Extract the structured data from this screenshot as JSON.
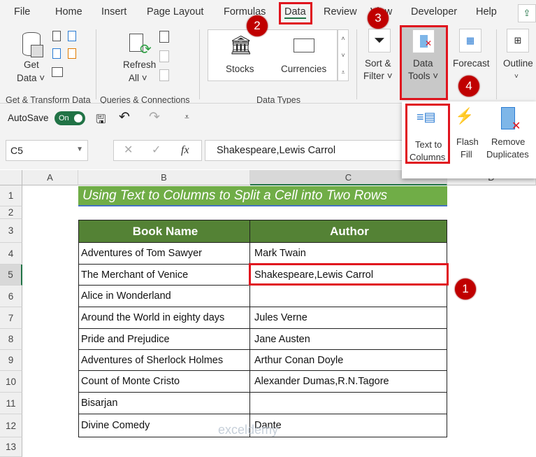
{
  "tabs": [
    "File",
    "Home",
    "Insert",
    "Page Layout",
    "Formulas",
    "Data",
    "Review",
    "View",
    "Developer",
    "Help"
  ],
  "active_tab": "Data",
  "ribbon": {
    "get_data": "Get",
    "get_data2": "Data ˅",
    "refresh": "Refresh",
    "refresh2": "All ˅",
    "stocks": "Stocks",
    "currencies": "Currencies",
    "sort": "Sort &",
    "sort2": "Filter ˅",
    "data_tools": "Data",
    "data_tools2": "Tools ˅",
    "forecast": "Forecast",
    "outline": "Outline",
    "groups": [
      "Get & Transform Data",
      "Queries & Connections",
      "Data Types"
    ]
  },
  "dropdown": {
    "text_to_columns": "Text to",
    "text_to_columns2": "Columns",
    "flash": "Flash",
    "flash2": "Fill",
    "remove": "Remove",
    "remove2": "Duplicates"
  },
  "qat": {
    "autosave": "AutoSave",
    "toggle": "On"
  },
  "formula_bar": {
    "name_box": "C5",
    "fx": "fx",
    "value": "Shakespeare,Lewis Carrol"
  },
  "steps": [
    "1",
    "2",
    "3",
    "4"
  ],
  "columns": [
    "A",
    "B",
    "C",
    "D"
  ],
  "rows": [
    "1",
    "2",
    "3",
    "4",
    "5",
    "6",
    "7",
    "8",
    "9",
    "10",
    "11",
    "12",
    "13"
  ],
  "sheet": {
    "title": "Using Text to Columns to Split a Cell into Two Rows",
    "headers": [
      "Book Name",
      "Author"
    ],
    "data": [
      [
        "Adventures of Tom Sawyer",
        "Mark Twain"
      ],
      [
        "The Merchant of Venice",
        "Shakespeare,Lewis Carrol"
      ],
      [
        "Alice in Wonderland",
        ""
      ],
      [
        "Around the World in eighty days",
        "Jules Verne"
      ],
      [
        "Pride and Prejudice",
        "Jane Austen"
      ],
      [
        "Adventures of Sherlock Holmes",
        "Arthur Conan Doyle"
      ],
      [
        "Count of Monte Cristo",
        "Alexander Dumas,R.N.Tagore"
      ],
      [
        "Bisarjan",
        ""
      ],
      [
        "Divine Comedy",
        "Dante"
      ]
    ]
  },
  "watermark": "exceldemy",
  "colors": {
    "title_bg": "#70ad47",
    "header_bg": "#548235",
    "accent": "#217346",
    "highlight": "#e0141e",
    "badge": "#c00000"
  }
}
